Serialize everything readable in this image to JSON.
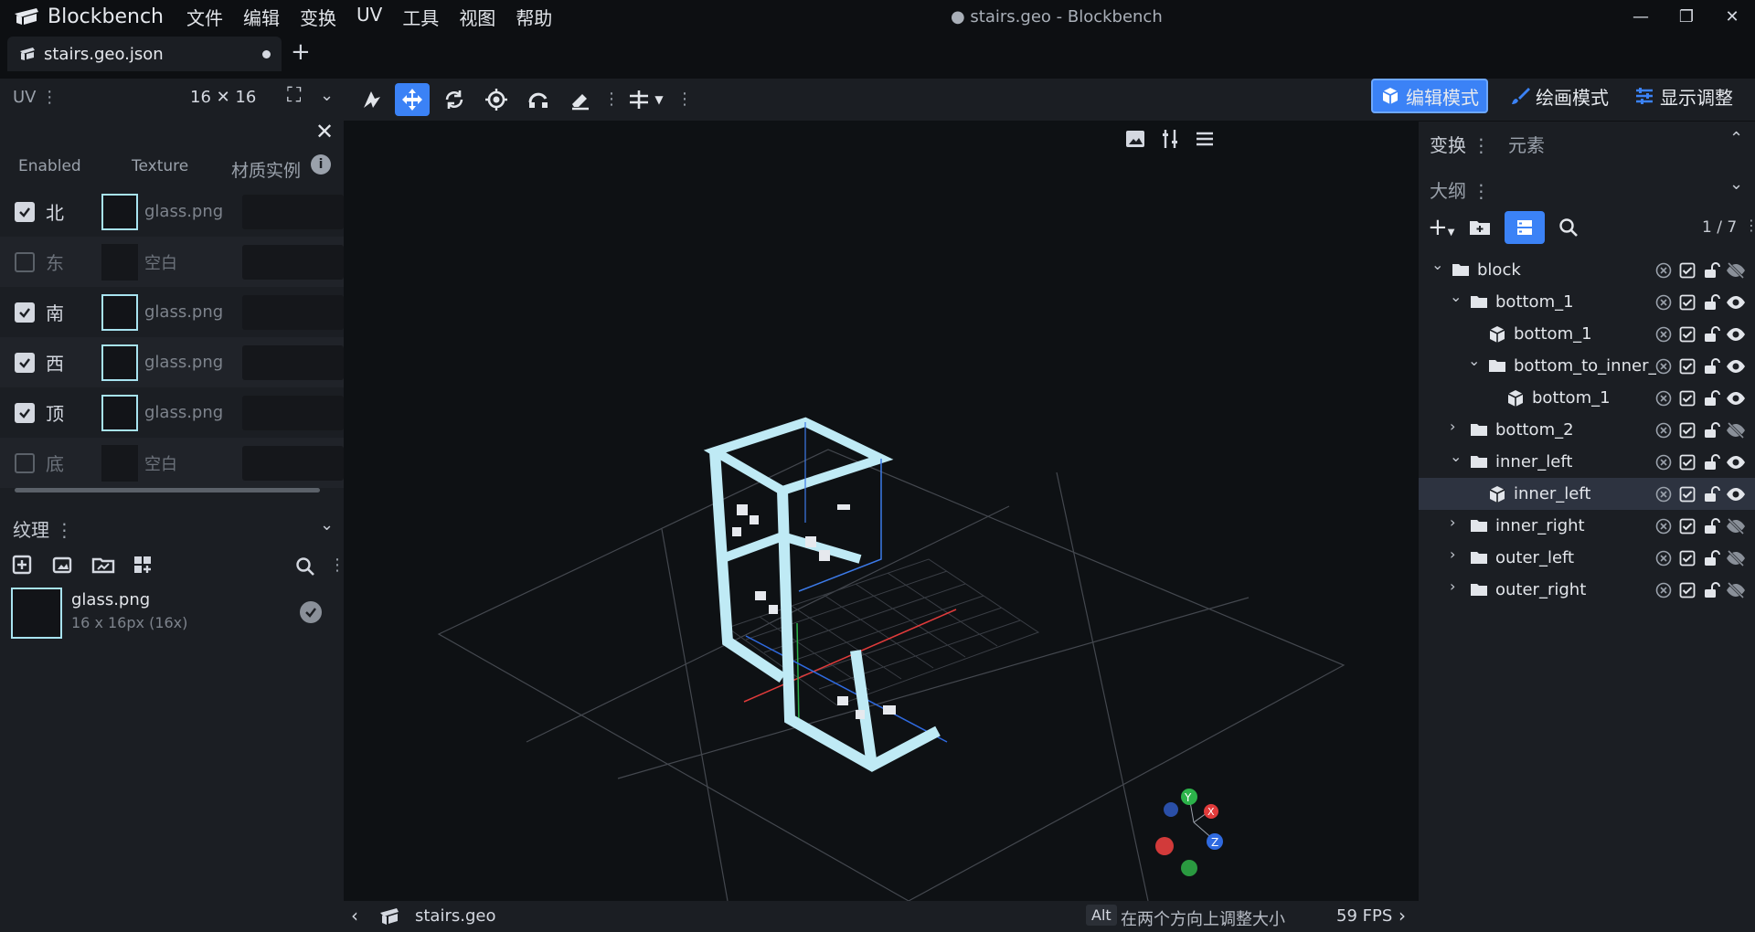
{
  "app": {
    "name": "Blockbench",
    "window_title": "● stairs.geo - Blockbench"
  },
  "menu": [
    "文件",
    "编辑",
    "变换",
    "UV",
    "工具",
    "视图",
    "帮助"
  ],
  "window_controls": {
    "minimize": "—",
    "restore": "❐",
    "close": "✕"
  },
  "tabs": [
    {
      "label": "stairs.geo.json"
    }
  ],
  "new_tab_label": "+",
  "uv_panel": {
    "title": "UV",
    "size": "16 ✕ 16",
    "headers": {
      "enabled": "Enabled",
      "texture": "Texture",
      "material": "材质实例"
    },
    "faces": [
      {
        "label": "北",
        "enabled": true,
        "texture": "glass.png"
      },
      {
        "label": "东",
        "enabled": false,
        "texture": "空白"
      },
      {
        "label": "南",
        "enabled": true,
        "texture": "glass.png"
      },
      {
        "label": "西",
        "enabled": true,
        "texture": "glass.png"
      },
      {
        "label": "顶",
        "enabled": true,
        "texture": "glass.png"
      },
      {
        "label": "底",
        "enabled": false,
        "texture": "空白"
      }
    ]
  },
  "texture_panel": {
    "title": "纹理",
    "items": [
      {
        "name": "glass.png",
        "info": "16 x 16px (16x)"
      }
    ]
  },
  "modes": {
    "edit": "编辑模式",
    "paint": "绘画模式",
    "display": "显示调整"
  },
  "right_tabs": {
    "transform": "变换",
    "element": "元素"
  },
  "outliner": {
    "title": "大纲",
    "count": "1 / 7",
    "nodes": [
      {
        "label": "block",
        "type": "folder",
        "depth": 0,
        "expanded": true,
        "visible": false
      },
      {
        "label": "bottom_1",
        "type": "folder",
        "depth": 1,
        "expanded": true,
        "visible": true
      },
      {
        "label": "bottom_1",
        "type": "cube",
        "depth": 2,
        "visible": true
      },
      {
        "label": "bottom_to_inner_",
        "type": "folder",
        "depth": 2,
        "expanded": true,
        "visible": true
      },
      {
        "label": "bottom_1",
        "type": "cube",
        "depth": 3,
        "visible": true
      },
      {
        "label": "bottom_2",
        "type": "folder",
        "depth": 1,
        "expanded": false,
        "visible": false
      },
      {
        "label": "inner_left",
        "type": "folder",
        "depth": 1,
        "expanded": true,
        "visible": true
      },
      {
        "label": "inner_left",
        "type": "cube",
        "depth": 2,
        "visible": true,
        "selected": true
      },
      {
        "label": "inner_right",
        "type": "folder",
        "depth": 1,
        "expanded": false,
        "visible": false
      },
      {
        "label": "outer_left",
        "type": "folder",
        "depth": 1,
        "expanded": false,
        "visible": false
      },
      {
        "label": "outer_right",
        "type": "folder",
        "depth": 1,
        "expanded": false,
        "visible": false
      }
    ]
  },
  "status": {
    "file": "stairs.geo",
    "key": "Alt",
    "hint": "在两个方向上调整大小",
    "fps": "59 FPS"
  },
  "gizmo": {
    "x": "X",
    "y": "Y",
    "z": "Z"
  },
  "colors": {
    "accent": "#3b82f6",
    "panel": "#1b1e23",
    "bg": "#0d0f12",
    "glass": "#a8e3f0"
  }
}
